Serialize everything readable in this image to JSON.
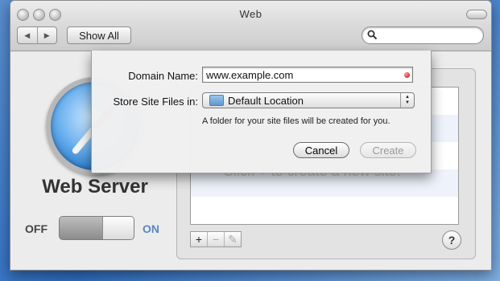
{
  "window": {
    "title": "Web"
  },
  "toolbar": {
    "back": "◀",
    "forward": "▶",
    "show_all": "Show All",
    "search_placeholder": ""
  },
  "pane": {
    "title": "Web Server",
    "toggle_off": "OFF",
    "toggle_on": "ON",
    "toggle_state": "on",
    "list_hint": "Click + to create a new site.",
    "add": "+",
    "remove": "−",
    "edit": "✎",
    "help": "?"
  },
  "sheet": {
    "domain_label": "Domain Name:",
    "domain_value": "www.example.com",
    "store_label": "Store Site Files in:",
    "store_value": "Default Location",
    "note": "A folder for your site files will be created for you.",
    "cancel": "Cancel",
    "create": "Create"
  },
  "colors": {
    "on_label": "#5a86c4",
    "error_dot": "#d10000"
  },
  "icons": [
    "search-icon",
    "compass-icon",
    "folder-icon",
    "pencil-icon",
    "help-icon"
  ]
}
